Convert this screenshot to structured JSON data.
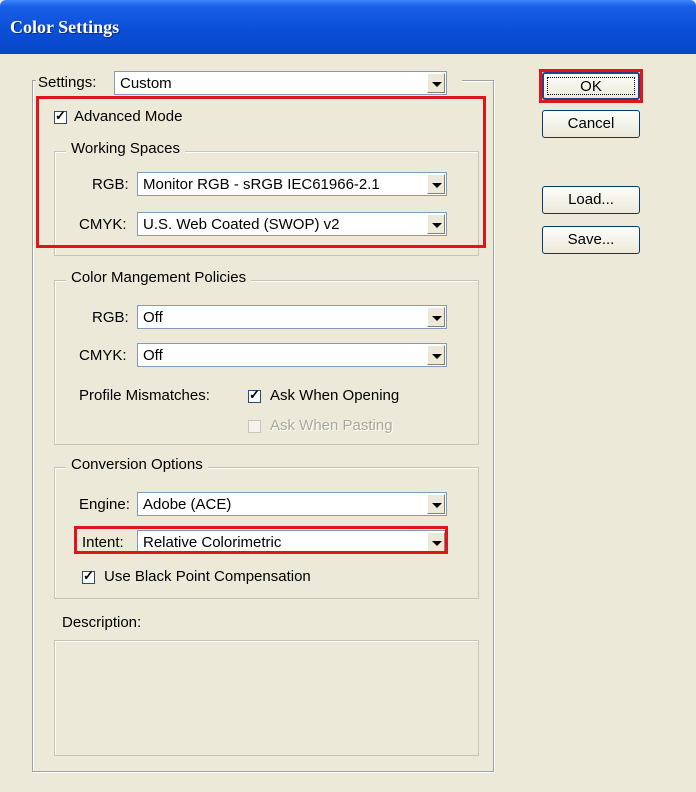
{
  "window": {
    "title": "Color Settings"
  },
  "settings": {
    "label": "Settings:",
    "value": "Custom"
  },
  "advanced_mode": {
    "label": "Advanced Mode",
    "checked": true
  },
  "working_spaces": {
    "title": "Working Spaces",
    "rgb_label": "RGB:",
    "rgb_value": "Monitor RGB - sRGB IEC61966-2.1",
    "cmyk_label": "CMYK:",
    "cmyk_value": "U.S. Web Coated (SWOP) v2"
  },
  "policies": {
    "title": "Color Mangement Policies",
    "rgb_label": "RGB:",
    "rgb_value": "Off",
    "cmyk_label": "CMYK:",
    "cmyk_value": "Off",
    "mismatch_label": "Profile Mismatches:",
    "ask_opening_label": "Ask When Opening",
    "ask_opening_checked": true,
    "ask_pasting_label": "Ask When Pasting",
    "ask_pasting_checked": false
  },
  "conversion": {
    "title": "Conversion Options",
    "engine_label": "Engine:",
    "engine_value": "Adobe (ACE)",
    "intent_label": "Intent:",
    "intent_value": "Relative Colorimetric",
    "bpc_label": "Use Black Point Compensation",
    "bpc_checked": true
  },
  "description": {
    "label": "Description:"
  },
  "buttons": {
    "ok": "OK",
    "cancel": "Cancel",
    "load": "Load...",
    "save": "Save..."
  },
  "colors": {
    "titlebar": "#0a4fd8",
    "highlight": "#e0141b",
    "window_bg": "#ece9d8"
  }
}
